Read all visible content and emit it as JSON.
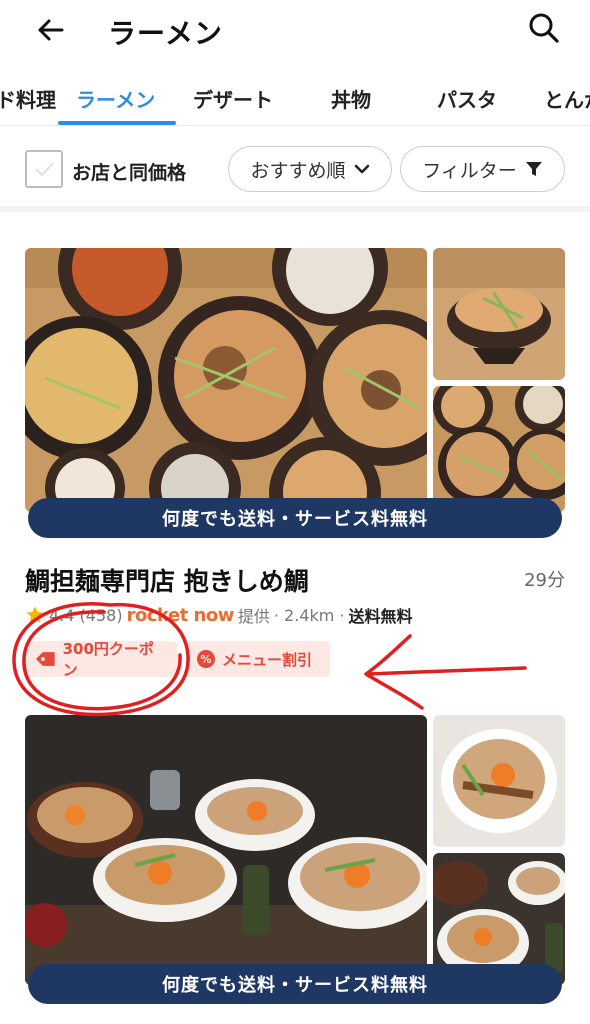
{
  "header": {
    "title": "ラーメン",
    "back_icon": "arrow-left-icon",
    "search_icon": "search-icon"
  },
  "tabs": [
    {
      "label": "ド料理"
    },
    {
      "label": "ラーメン",
      "active": true
    },
    {
      "label": "デザート"
    },
    {
      "label": "丼物"
    },
    {
      "label": "パスタ"
    },
    {
      "label": "とんか"
    }
  ],
  "filters": {
    "same_price_label": "お店と同価格",
    "sort_label": "おすすめ順",
    "filter_label": "フィルター"
  },
  "restaurants": [
    {
      "banner": "何度でも送料・サービス料無料",
      "name": "鯛担麺専門店 抱きしめ鯛",
      "time": "29分",
      "rating": "4.4 (458)",
      "provider": "rocket now",
      "provider_suffix": "提供",
      "distance": "· 2.4km ·",
      "delivery": "送料無料",
      "badges": [
        "300円クーポン",
        "メニュー割引"
      ]
    },
    {
      "banner": "何度でも送料・サービス料無料"
    }
  ],
  "colors": {
    "accent": "#2b8fe0",
    "banner": "#1f3763",
    "badge_bg": "#fde8e4",
    "badge_text": "#e34a3c",
    "annotation": "#e02020",
    "brand": "#f06a2d"
  }
}
